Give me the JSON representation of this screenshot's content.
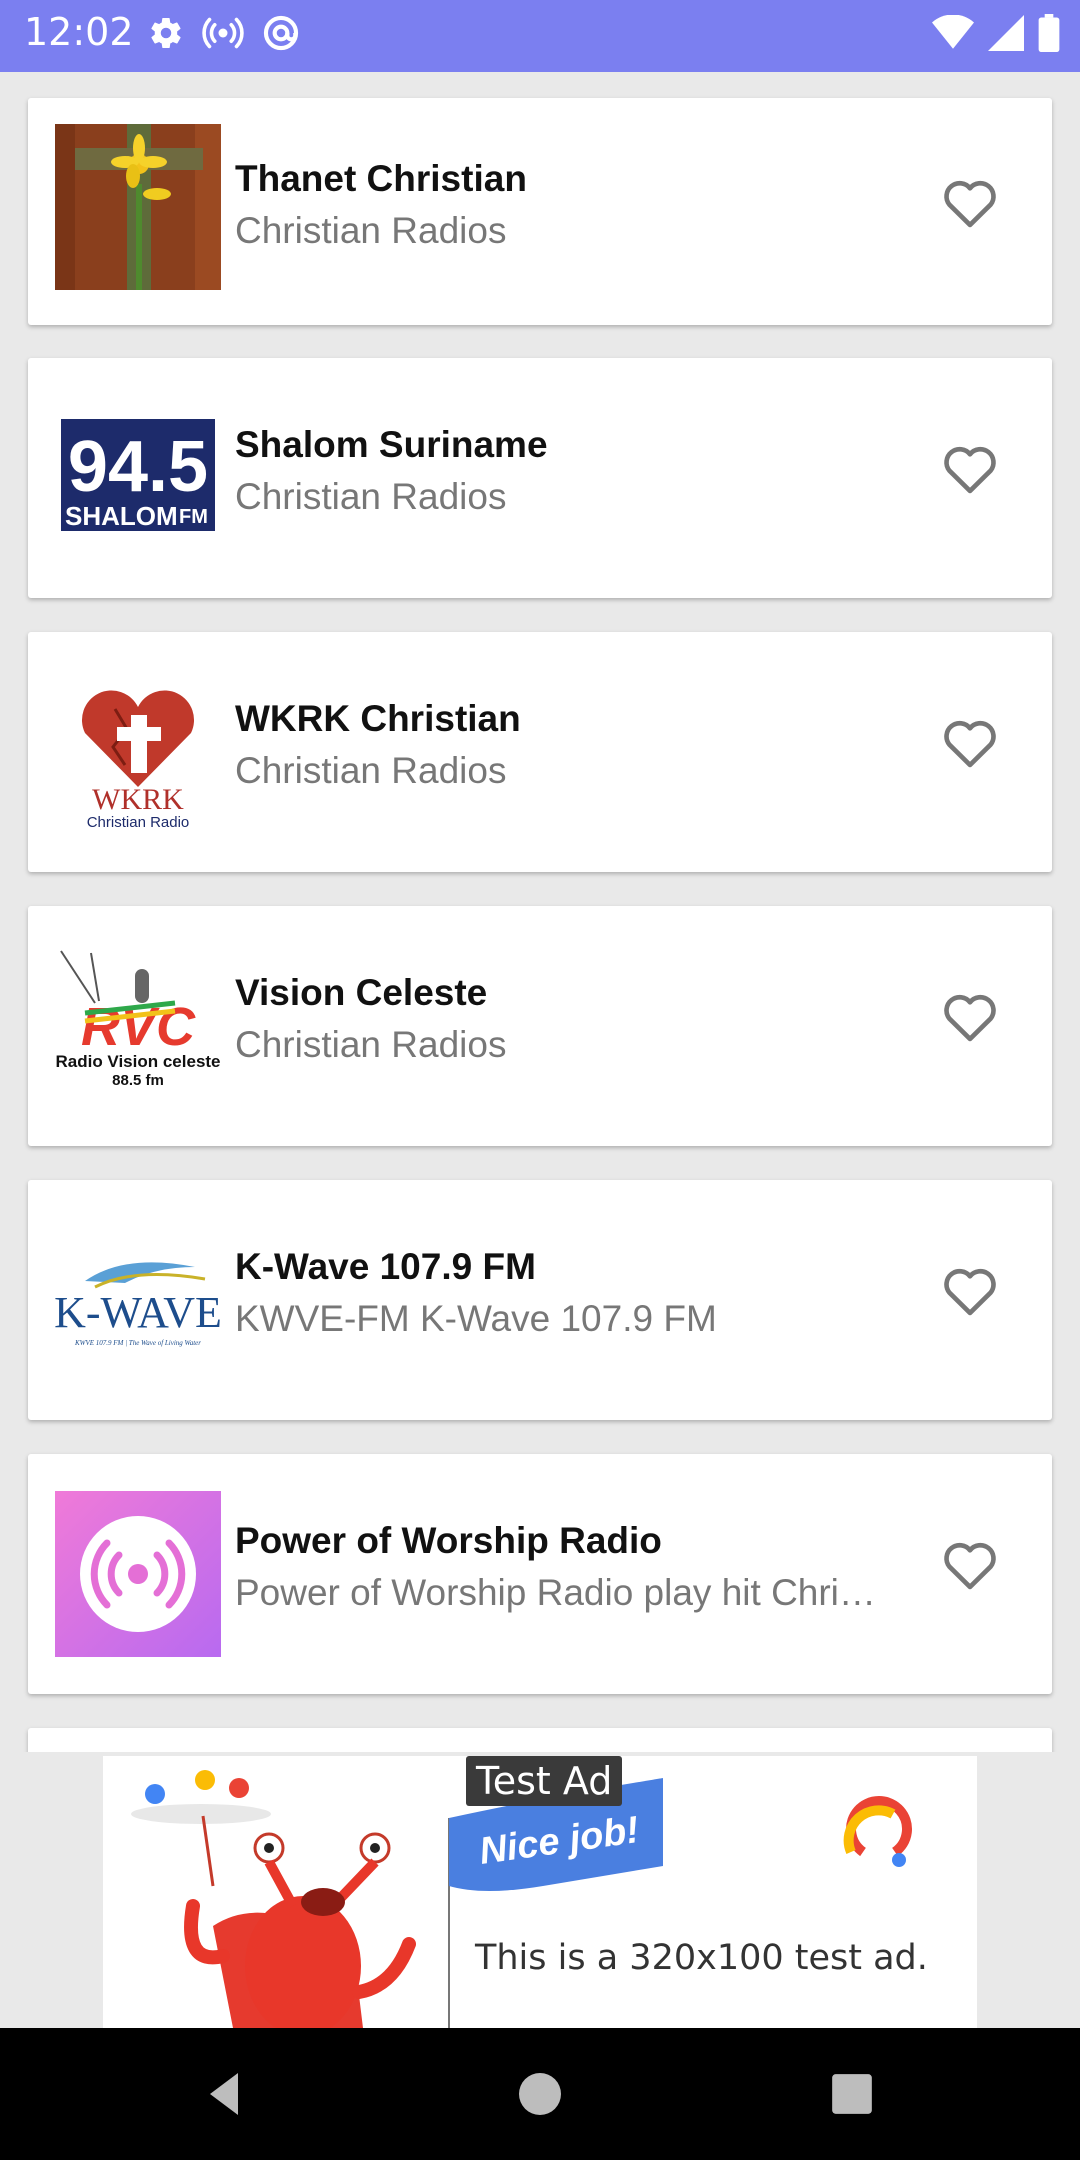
{
  "status_bar": {
    "time": "12:02",
    "icons": [
      "gear-icon",
      "broadcast-icon",
      "at-sign-icon",
      "wifi-icon",
      "signal-icon",
      "battery-icon"
    ],
    "background": "#7b7ff0"
  },
  "stations": [
    {
      "title": "Thanet Christian",
      "subtitle": "Christian Radios",
      "logo": "cross-flower-logo"
    },
    {
      "title": "Shalom Suriname",
      "subtitle": "Christian Radios",
      "logo": "shalom-fm-logo",
      "logo_text_1": "94.5",
      "logo_text_2": "SHALOM",
      "logo_text_3": "FM"
    },
    {
      "title": "WKRK Christian",
      "subtitle": "Christian Radios",
      "logo": "wkrk-heart-logo",
      "logo_text_1": "WKRK",
      "logo_text_2": "Christian Radio"
    },
    {
      "title": "Vision Celeste",
      "subtitle": "Christian Radios",
      "logo": "rvc-logo",
      "logo_text_1": "RVC",
      "logo_text_2": "Radio Vision celeste",
      "logo_text_3": "88.5 fm"
    },
    {
      "title": "K-Wave 107.9 FM",
      "subtitle": "KWVE-FM K-Wave 107.9 FM",
      "logo": "kwave-logo",
      "logo_text_1": "K-WAVE",
      "logo_text_2": "KWVE 107.9 FM | The Wave of Living Water"
    },
    {
      "title": "Power of Worship Radio",
      "subtitle": "Power of Worship Radio play hit Chri…",
      "logo": "podcast-broadcast-logo"
    }
  ],
  "ad": {
    "label": "Test Ad",
    "banner": "Nice job!",
    "text": "This is a 320x100 test ad."
  },
  "colors": {
    "heart_outline": "#777777",
    "title": "#111111",
    "subtitle": "#777777"
  }
}
